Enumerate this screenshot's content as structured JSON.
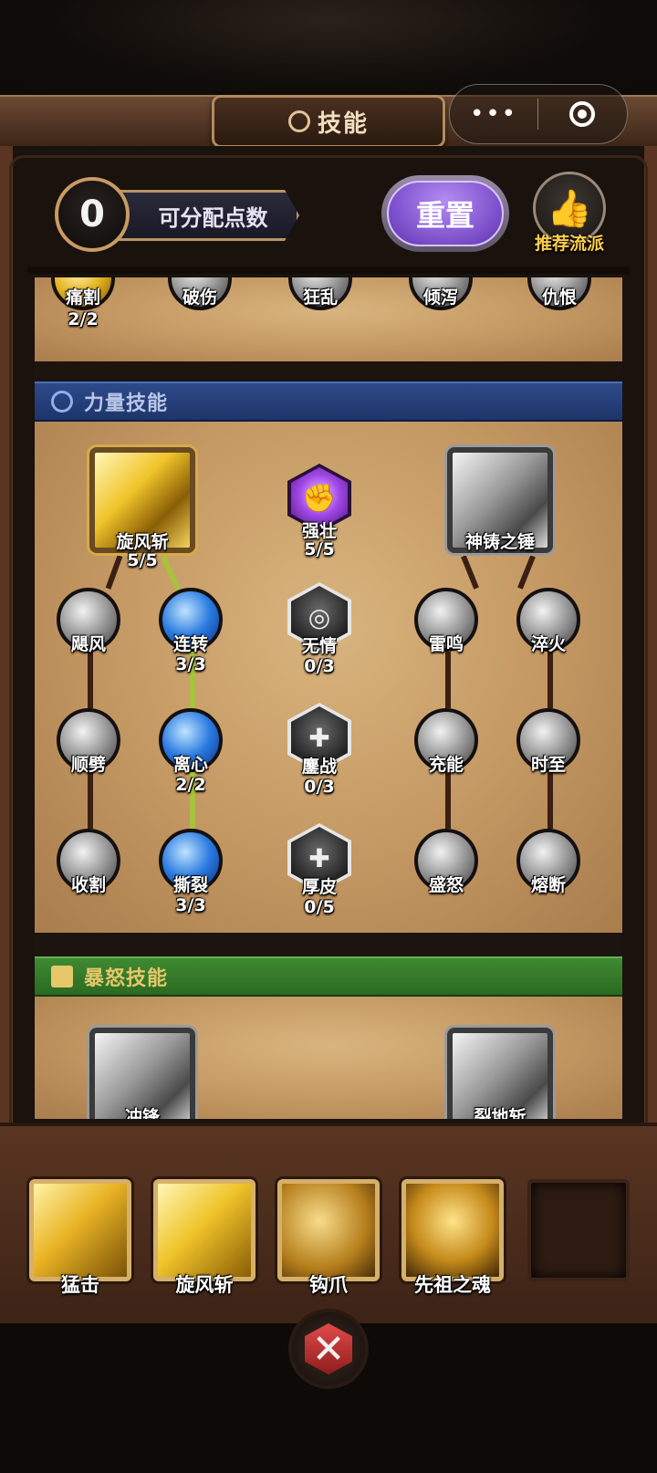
{
  "header": {
    "title": "技能"
  },
  "capsule": {
    "more": "•••"
  },
  "points": {
    "value": "0",
    "label": "可分配点数"
  },
  "reset_button": "重置",
  "recommend": {
    "label": "推荐流派"
  },
  "top_row": [
    {
      "name": "痛割",
      "level": "2/2"
    },
    {
      "name": "破伤",
      "level": ""
    },
    {
      "name": "狂乱",
      "level": ""
    },
    {
      "name": "倾泻",
      "level": ""
    },
    {
      "name": "仇恨",
      "level": ""
    }
  ],
  "strength_section": {
    "title": "力量技能",
    "main_left": {
      "name": "旋风斩",
      "level": "5/5"
    },
    "main_center": {
      "name": "强壮",
      "level": "5/5"
    },
    "main_right": {
      "name": "神铸之锤",
      "level": ""
    },
    "col1": [
      {
        "name": "飓风",
        "level": ""
      },
      {
        "name": "顺劈",
        "level": ""
      },
      {
        "name": "收割",
        "level": ""
      }
    ],
    "col2": [
      {
        "name": "连转",
        "level": "3/3"
      },
      {
        "name": "离心",
        "level": "2/2"
      },
      {
        "name": "撕裂",
        "level": "3/3"
      }
    ],
    "col3": [
      {
        "name": "无情",
        "level": "0/3"
      },
      {
        "name": "鏖战",
        "level": "0/3"
      },
      {
        "name": "厚皮",
        "level": "0/5"
      }
    ],
    "col4": [
      {
        "name": "雷鸣",
        "level": ""
      },
      {
        "name": "充能",
        "level": ""
      },
      {
        "name": "盛怒",
        "level": ""
      }
    ],
    "col5": [
      {
        "name": "淬火",
        "level": ""
      },
      {
        "name": "时至",
        "level": ""
      },
      {
        "name": "熔断",
        "level": ""
      }
    ]
  },
  "rage_section": {
    "title": "暴怒技能",
    "left": {
      "name": "冲锋"
    },
    "right": {
      "name": "裂地斩"
    }
  },
  "equipped": [
    {
      "name": "猛击"
    },
    {
      "name": "旋风斩"
    },
    {
      "name": "钩爪"
    },
    {
      "name": "先祖之魂"
    },
    {
      "name": ""
    }
  ],
  "colors": {
    "gold": "#f0c42a",
    "purple": "#7a4dc9",
    "blue_header": "#2d4a8a",
    "green_header": "#3f8a32"
  },
  "icons": {
    "close": "x-gem-icon",
    "recommend": "thumbs-up-icon"
  }
}
